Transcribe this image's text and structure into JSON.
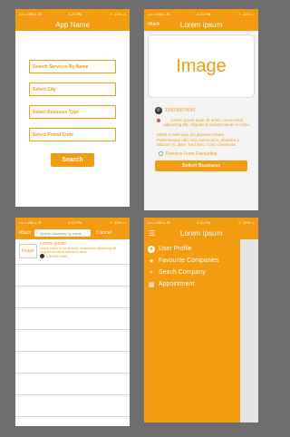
{
  "status": {
    "carrier": "•••○○ BELL ☰",
    "time": "4:21 PM",
    "battery": "⚡ 22% ▭"
  },
  "screen1": {
    "title": "App Name",
    "fields": [
      "Search Services By Name",
      "Select City",
      "Select Business Type",
      "Select Postal Code"
    ],
    "search_label": "Search"
  },
  "screen2": {
    "back_label": "<Back",
    "title": "Lorem ipsum",
    "image_label": "Image",
    "phone": "130036874545",
    "address": "Lorem ipsum dolor sit amet, consectetur adipiscing elit. Aliquam tincidunt mauris eu risus.",
    "description": "Morbi in sem quis dui placerat ornare. Pellentesque odio nisi, euismod in, pharetra a, ultricies in, diam. Sed arcu. Cras consequat.",
    "remove_label": "Remove From Favourites",
    "select_label": "Select Business"
  },
  "screen3": {
    "back_label": "<Back",
    "search_placeholder": "Search business by name",
    "cancel_label": "Cancel",
    "result": {
      "thumb": "Image",
      "title": "Lorem ipsum",
      "text": "Lorem ipsum dolor sit amet, consectetur adipiscing elit. Aliquam tincidunt mauris eu risus.",
      "phone": "130036874545"
    }
  },
  "screen4": {
    "title": "Lorem ipsum",
    "menu": [
      {
        "label": "User Profile",
        "icon": "user-icon"
      },
      {
        "label": "Favourite Companies",
        "icon": "star-icon"
      },
      {
        "label": "Seach Company",
        "icon": "search-icon"
      },
      {
        "label": "Appointment",
        "icon": "calendar-icon"
      }
    ]
  },
  "colors": {
    "accent": "#f39c12",
    "background": "#6e6e6e",
    "error_dot": "#e74c3c"
  }
}
